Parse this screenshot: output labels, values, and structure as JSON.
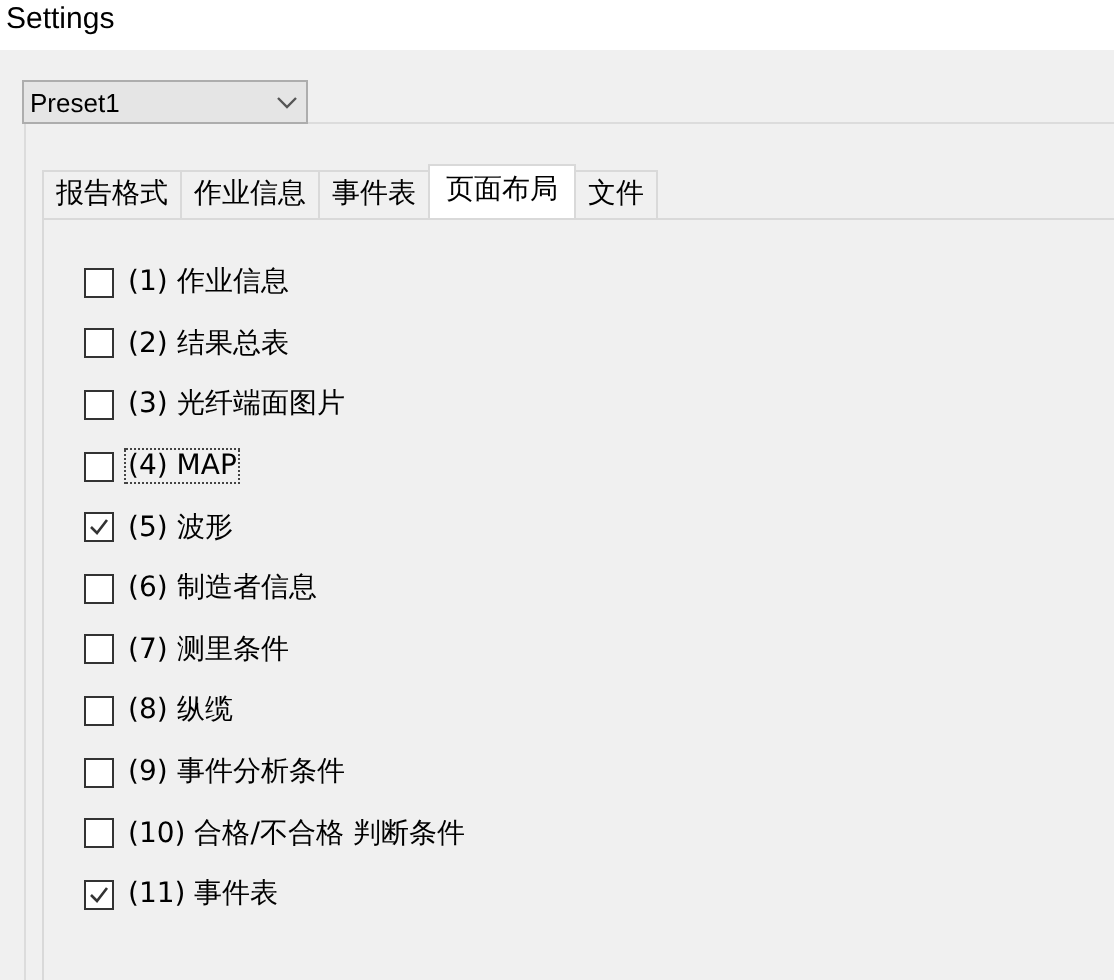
{
  "window": {
    "title": "Settings"
  },
  "preset": {
    "value": "Preset1"
  },
  "tabs": [
    {
      "label": "报告格式",
      "selected": false
    },
    {
      "label": "作业信息",
      "selected": false
    },
    {
      "label": "事件表",
      "selected": false
    },
    {
      "label": "页面布局",
      "selected": true
    },
    {
      "label": "文件",
      "selected": false
    }
  ],
  "items": [
    {
      "label": "(1) 作业信息",
      "checked": false,
      "focused": false
    },
    {
      "label": "(2) 结果总表",
      "checked": false,
      "focused": false
    },
    {
      "label": "(3) 光纤端面图片",
      "checked": false,
      "focused": false
    },
    {
      "label": "(4) MAP",
      "checked": false,
      "focused": true
    },
    {
      "label": "(5) 波形",
      "checked": true,
      "focused": false
    },
    {
      "label": "(6) 制造者信息",
      "checked": false,
      "focused": false
    },
    {
      "label": "(7) 测里条件",
      "checked": false,
      "focused": false
    },
    {
      "label": "(8) 纵缆",
      "checked": false,
      "focused": false
    },
    {
      "label": "(9) 事件分析条件",
      "checked": false,
      "focused": false
    },
    {
      "label": "(10) 合格/不合格 判断条件",
      "checked": false,
      "focused": false
    },
    {
      "label": "(11) 事件表",
      "checked": true,
      "focused": false
    }
  ]
}
